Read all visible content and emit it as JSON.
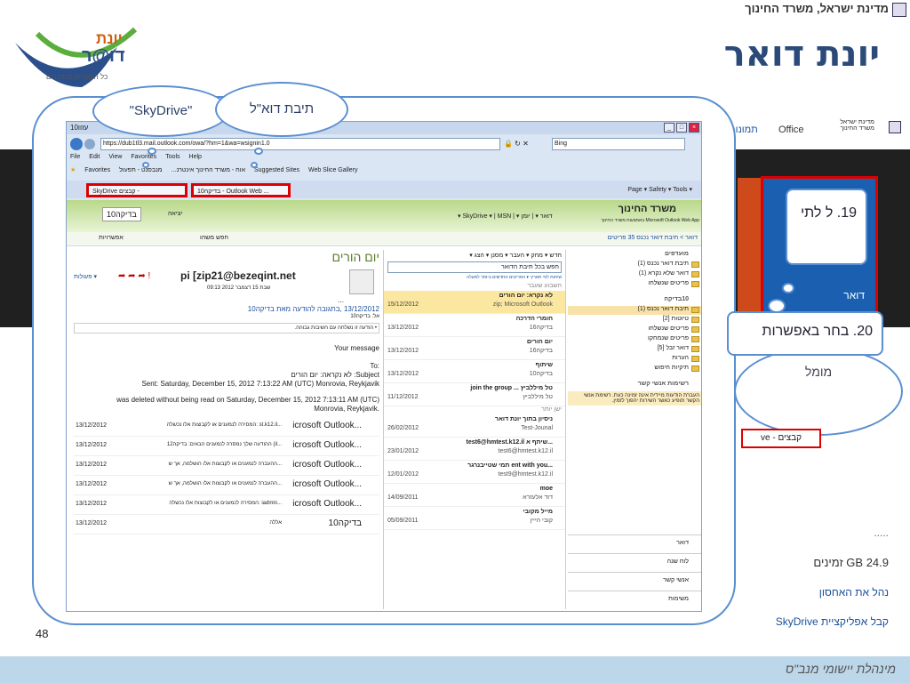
{
  "gov": {
    "ministry": "מדינת ישראל, משרד החינוך"
  },
  "page": {
    "title": "יונת דואר",
    "page_number": "48",
    "footer": "מינהלת יישומי מנב\"ס"
  },
  "logo": {
    "line1": "יונת",
    "line2": "דו@ר",
    "tagline": "כל הקשרים מחוברים"
  },
  "office_bar": {
    "ministry": "מדינת ישראל משרד החינוך",
    "office": "Office",
    "photos": "תמונות"
  },
  "tile": {
    "label": "דואר"
  },
  "storage": {
    "size": "24.9 GB זמינים",
    "manage": "נהל את האחסון",
    "get_app": "קבל אפליקציית SkyDrive",
    "dots": "....."
  },
  "callouts": {
    "skydrive": "\"SkyDrive\"",
    "owa": "תיבת דוא\"ל",
    "step19": "19. ל לתי",
    "step20": "20. בחר באפשרות",
    "right_cloud": "מומל",
    "skydrive_btn": "קבצים - ve"
  },
  "browser": {
    "title": "10עזוו",
    "url": "https://dub1tl3.mail.outlook.com/owa/?hm=1&wa=wsignin1.0",
    "search_placeholder": "Bing",
    "menu": [
      "File",
      "Edit",
      "View",
      "Favorites",
      "Tools",
      "Help"
    ],
    "favorites": [
      "Favorites",
      "אוח - משרד החינוך אינטרנ...",
      "מנבסנט - תפעול",
      "Suggested Sites",
      "Web Slice Gallery"
    ],
    "tab_skydrive": "SkyDrive קבצים -",
    "tab_owa": "10בדיקה - Outlook Web ...",
    "toolbar_right": "Page ▾  Safety ▾  Tools ▾"
  },
  "owa": {
    "brand": "משרד החינוך",
    "brand_sub": "Microsoft Outlook Web App באמצעות משרד החינוך",
    "user": "10בדיקה",
    "signout": "יציאה",
    "nav": [
      "דואר",
      "יומן",
      "SkyDrive",
      "MSN"
    ],
    "breadcrumb": "דואר > תיבת דואר נכנס 35 פריטים",
    "find_someone": "חפש משהו",
    "options": "אפשרויות",
    "toolbar": "חדש ▾ מחק ▾ העבר ▾ מסנן ▾ הצג ▾",
    "search_box": "חפש בכל תיבת הדואר",
    "sort": "שיחות לפי תאריך ▾ הפריטים החדשים ביותר למעלה",
    "favorites_title": "מועדפים",
    "favorites": [
      "תיבת דואר נכנס (1)",
      "דואר שלא נקרא (1)",
      "פריטים שנשלחו"
    ],
    "mailbox_title": "10בדיקה",
    "folders": [
      "תיבת דואר נכנס (1)",
      "טיוטות [2]",
      "פריטים שנשלחו",
      "פריטים שנמחקו",
      "דואר זבל [5]",
      "הערות",
      "תיקיות חיפוש"
    ],
    "contacts_title": "רשימות אנשי קשר",
    "contacts_note": "העברת הודעות מיידית אינה זמינה כעת. רשימת אנשי הקשר תופיע כאשר השירות יהפוך לזמין.",
    "bottom_nav": [
      "דואר",
      "לוח שנה",
      "אנשי קשר",
      "משימות"
    ],
    "last_week": "השבוע שעבר",
    "older": "ישן יותר",
    "messages": [
      {
        "from": "לא נקרא: יום הורים",
        "sub": "zip; Microsoft Outlook",
        "date": "15/12/2012"
      },
      {
        "from": "חומרי הדרכה",
        "sub": "בדיקה16",
        "date": "13/12/2012"
      },
      {
        "from": "יום הורים",
        "sub": "בדיקה16",
        "date": "13/12/2012"
      },
      {
        "from": "שיתוף",
        "sub": "בדיקה10",
        "date": "13/12/2012"
      },
      {
        "from": "join the group ... טל מיללביץ",
        "sub": "טל מיללביץ",
        "date": "11/12/2012"
      },
      {
        "from": "ניסיון בתוך יונת דואר",
        "sub": "Test-Jounal",
        "date": "26/02/2012"
      },
      {
        "from": "test6@hmtest.k12.il שיתף א...",
        "sub": "test6@hmtest.k12.il",
        "date": "23/01/2012"
      },
      {
        "from": "תמי שטייבנרגר ent with you...",
        "sub": "test9@hmtest.k12.il",
        "date": "12/01/2012"
      },
      {
        "from": "moe",
        "sub": "דוד אלעזרא",
        "date": "14/09/2011"
      },
      {
        "from": "מייל מקובי",
        "sub": "קובי הייין",
        "date": "05/09/2011"
      }
    ],
    "reading": {
      "subject": "יום הורים",
      "actions": "פעולות ▾",
      "sender": "pi [zip21@bezeqint.net",
      "sent": "שבת 15 דצמבר 2012 09:13",
      "ellipsis": "...",
      "reply_note": "13/12/2012 ,בתגובה להודעה מאת בדיקה10",
      "to": "אל: בדיקה10",
      "importance": "• הודעה זו נשלחה עם חשיבות גבוהה.",
      "your_message": "Your message",
      "to_label": ":To",
      "subject_line": "Subject: לא נקראה: יום הורים",
      "sent_line": "Sent: Saturday, December 15, 2012 7:13:22 AM (UTC) Monrovia, Reykjavik",
      "deleted_line": "was deleted without being read on Saturday, December 15, 2012 7:13:11 AM (UTC)",
      "deleted_line2": ".Monrovia, Reykjavik",
      "rows": [
        {
          "from": "icrosoft Outlook...",
          "subj": "המסירה לנמענים או לקבוצות אלו נכשלה: st.k12.il...",
          "date": "13/12/2012"
        },
        {
          "from": "icrosoft Outlook...",
          "subj": "ההודעה שלך נמסרה לנמענים הבאים: בדיקה12 (il...",
          "date": "13/12/2012"
        },
        {
          "from": "icrosoft Outlook...",
          "subj": "ההעברה לנמענים או לקבוצות אלו הושלמה, אך ש...",
          "date": "13/12/2012"
        },
        {
          "from": "icrosoft Outlook...",
          "subj": "ההעברה לנמענים או לקבוצות אלו הושלמה, אך ש...",
          "date": "13/12/2012"
        },
        {
          "from": "icrosoft Outlook...",
          "subj": "המסירה לנמענים או לקבוצות אלו נכשלה: iadmin...",
          "date": "13/12/2012"
        },
        {
          "from": "10בדיקה",
          "subj": "אללה",
          "date": "13/12/2012"
        }
      ]
    }
  },
  "colors": {
    "accent": "#5a8fd0",
    "tile": "#1a5fb0",
    "highlight": "#d00000",
    "owa_green": "#b8d889"
  }
}
